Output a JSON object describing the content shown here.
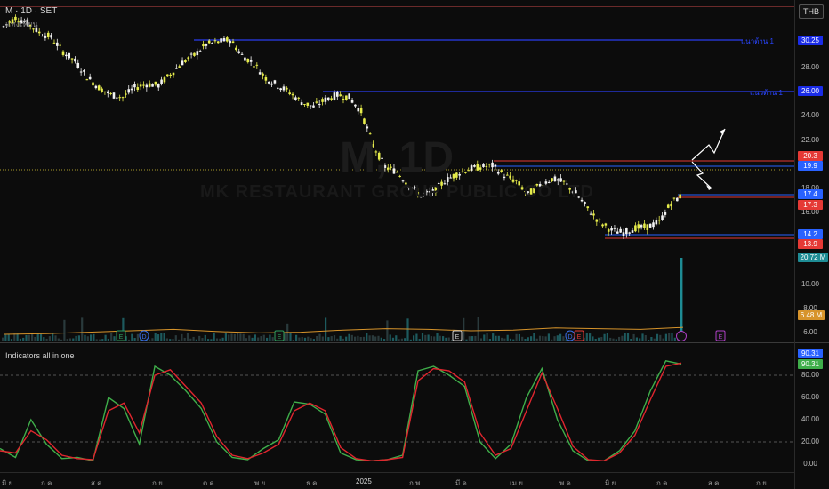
{
  "header": {
    "title": "M · 1D · SET",
    "subtitle": "แท่งเทียน",
    "currency": "THB",
    "watermark": "M, 1D",
    "watermark2": "MK RESTAURANT GROUP PUBLIC CO LTD"
  },
  "price_axis": {
    "labels": [
      "28.00",
      "24.00",
      "22.00",
      "18.00",
      "16.00",
      "10.00",
      "8.00",
      "6.00"
    ]
  },
  "tags": {
    "resistance_high": "30.25",
    "resistance_mid": "26.00",
    "level_203": "20.3",
    "last_price": "19.9",
    "level_174": "17.4",
    "level_173": "17.3",
    "level_142": "14.2",
    "level_139": "13.9",
    "volume": "20.72 M",
    "volume_ma": "6.48 M",
    "osc_k": "90.31",
    "osc_d": "90.31"
  },
  "level_labels": {
    "high": "แนวต้าน 1",
    "mid": "แนวต้าน 1"
  },
  "indicator": {
    "title": "Indicators all in one",
    "axis": [
      "80.00",
      "60.00",
      "40.00",
      "20.00",
      "0.00"
    ]
  },
  "x_axis": {
    "labels": [
      "มิ.ย.",
      "ก.ค.",
      "ส.ค.",
      "ก.ย.",
      "ต.ค.",
      "พ.ย.",
      "ธ.ค.",
      "2025",
      "ก.พ.",
      "มี.ค.",
      "เม.ย.",
      "พ.ค.",
      "มิ.ย.",
      "ก.ค.",
      "ส.ค.",
      "ก.ย."
    ]
  },
  "events": [
    "E",
    "D",
    "E",
    "E",
    "D",
    "E",
    "E"
  ],
  "colors": {
    "bull": "#f2f2f2",
    "bear": "#e6ec4b",
    "level_line": "#2a3cf0",
    "red_tag": "#e53935",
    "blue_tag": "#2962ff",
    "k_line": "#3fae4a",
    "d_line": "#e0262e"
  },
  "chart_data": {
    "type": "candlestick",
    "price": [
      31.5,
      32.2,
      31.8,
      31.0,
      30.6,
      29.4,
      28.6,
      27.3,
      26.4,
      25.8,
      25.6,
      26.4,
      26.7,
      26.6,
      27.5,
      28.5,
      29.1,
      30.0,
      30.2,
      30.4,
      29.1,
      28.4,
      27.2,
      26.6,
      26.0,
      25.2,
      24.8,
      25.4,
      25.8,
      25.6,
      24.4,
      21.6,
      19.8,
      19.4,
      18.3,
      17.4,
      17.7,
      18.6,
      19.2,
      19.6,
      19.8,
      19.9,
      19.1,
      18.6,
      17.5,
      18.3,
      18.8,
      18.5,
      17.6,
      16.3,
      15.2,
      14.5,
      14.3,
      14.7,
      14.8,
      15.2,
      16.8,
      17.5
    ],
    "stoch_k": [
      14,
      6,
      40,
      18,
      5,
      6,
      3,
      60,
      50,
      18,
      88,
      80,
      66,
      50,
      20,
      6,
      4,
      14,
      22,
      56,
      54,
      45,
      10,
      4,
      3,
      4,
      8,
      84,
      88,
      80,
      70,
      20,
      5,
      18,
      60,
      86,
      40,
      12,
      3,
      3,
      12,
      30,
      66,
      93,
      90
    ],
    "stoch_d": [
      12,
      10,
      30,
      22,
      8,
      5,
      4,
      48,
      55,
      28,
      80,
      85,
      70,
      55,
      25,
      8,
      5,
      10,
      18,
      48,
      55,
      48,
      15,
      5,
      3,
      4,
      6,
      75,
      86,
      84,
      74,
      28,
      8,
      14,
      48,
      82,
      50,
      16,
      4,
      3,
      10,
      26,
      58,
      88,
      91
    ],
    "volume_ma": [
      5.5,
      5.6,
      5.8,
      6.0,
      6.2,
      5.9,
      5.7,
      5.8,
      6.1,
      6.3,
      6.2,
      6.0,
      6.1,
      6.4,
      6.3,
      6.2,
      6.48
    ]
  }
}
